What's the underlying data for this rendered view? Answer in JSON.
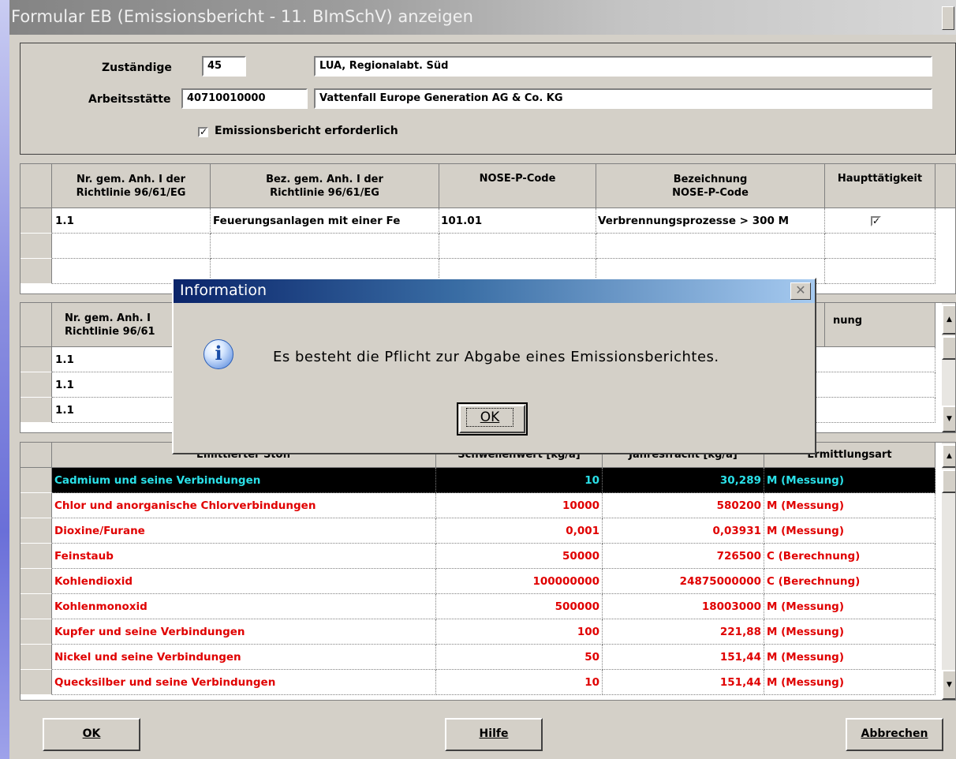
{
  "window": {
    "title": "Formular EB (Emissionsbericht - 11. BImSchV) anzeigen"
  },
  "header": {
    "zustaendige_label": "Zuständige",
    "zustaendige_code": "45",
    "zustaendige_name": "LUA, Regionalabt. Süd",
    "arbeitsstaette_label": "Arbeitsstätte",
    "arbeitsstaette_code": "40710010000",
    "arbeitsstaette_name": "Vattenfall Europe Generation AG & Co. KG",
    "emissionsbericht_label": "Emissionsbericht erforderlich",
    "emissionsbericht_checked": true
  },
  "grid1": {
    "columns": [
      "Nr. gem. Anh. I der\nRichtlinie 96/61/EG",
      "Bez. gem. Anh. I der\nRichtlinie 96/61/EG",
      "NOSE-P-Code",
      "Bezeichnung\nNOSE-P-Code",
      "Haupttätigkeit"
    ],
    "rows": [
      [
        "1.1",
        "Feuerungsanlagen mit einer Fe",
        "101.01",
        "Verbrennungsprozesse > 300 M",
        true
      ],
      [
        "",
        "",
        "",
        "",
        false
      ],
      [
        "",
        "",
        "",
        "",
        false
      ]
    ]
  },
  "grid2": {
    "col1": "Nr. gem. Anh. I\nRichtlinie 96/61",
    "col_last": "nung",
    "rows": [
      "1.1",
      "1.1",
      "1.1"
    ]
  },
  "grid3": {
    "columns": [
      "Emittierter Stoff",
      "Schwellenwert [kg/a]",
      "Jahresfracht [kg/a]",
      "Ermittlungsart"
    ],
    "rows": [
      [
        "Cadmium und seine Verbindungen",
        "10",
        "30,289",
        "M (Messung)"
      ],
      [
        "Chlor und anorganische Chlorverbindungen",
        "10000",
        "580200",
        "M (Messung)"
      ],
      [
        "Dioxine/Furane",
        "0,001",
        "0,03931",
        "M (Messung)"
      ],
      [
        "Feinstaub",
        "50000",
        "726500",
        "C (Berechnung)"
      ],
      [
        "Kohlendioxid",
        "100000000",
        "24875000000",
        "C (Berechnung)"
      ],
      [
        "Kohlenmonoxid",
        "500000",
        "18003000",
        "M (Messung)"
      ],
      [
        "Kupfer und seine Verbindungen",
        "100",
        "221,88",
        "M (Messung)"
      ],
      [
        "Nickel und seine Verbindungen",
        "50",
        "151,44",
        "M (Messung)"
      ],
      [
        "Quecksilber und seine Verbindungen",
        "10",
        "151,44",
        "M (Messung)"
      ]
    ]
  },
  "buttons": {
    "ok": "OK",
    "hilfe": "Hilfe",
    "abbrechen": "Abbrechen"
  },
  "dialog": {
    "title": "Information",
    "message": "Es besteht die Pflicht zur Abgabe eines Emissionsberichtes.",
    "ok": "OK",
    "icon": "info-icon"
  },
  "colors": {
    "selected_text": "#2ae0e8",
    "row_text": "#e00000",
    "title_bar": "#0a246a"
  }
}
